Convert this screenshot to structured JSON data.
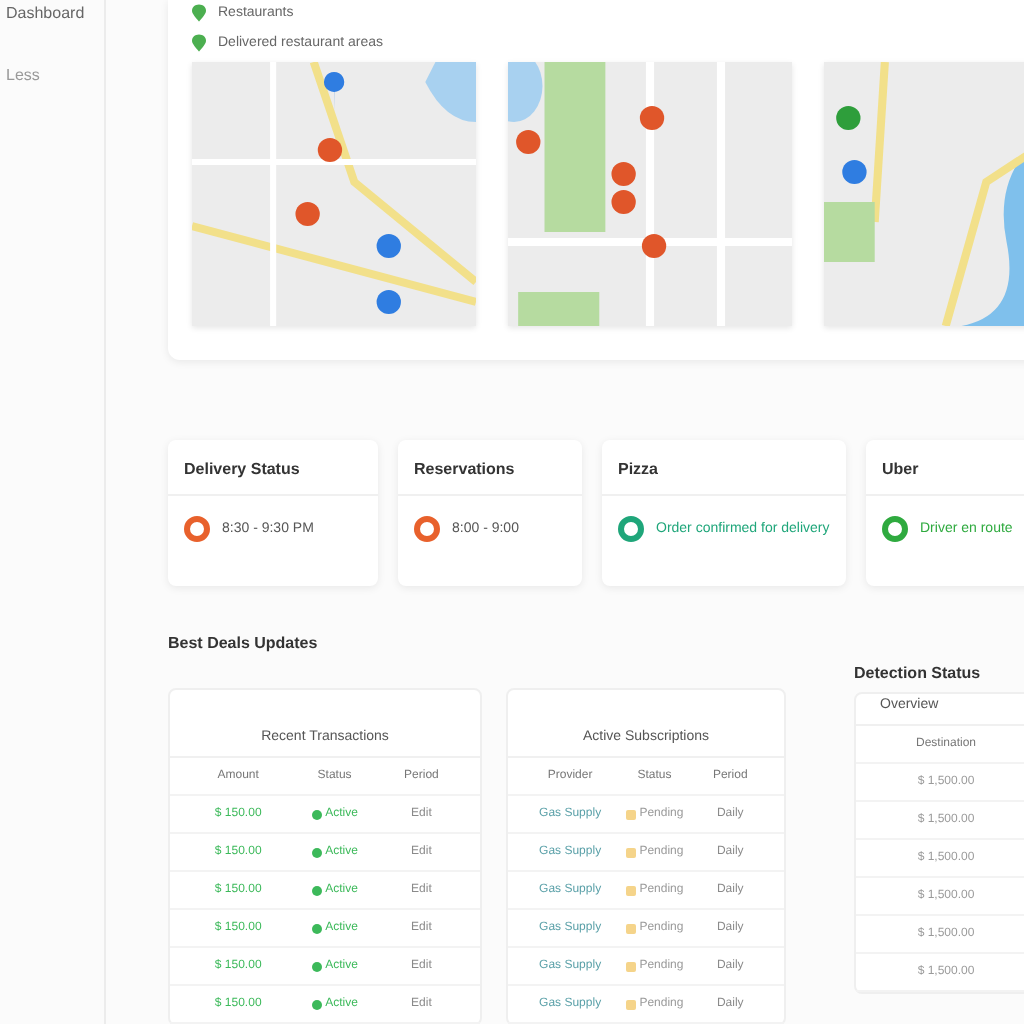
{
  "sidebar": {
    "items": [
      {
        "label": "Dashboard",
        "selected": true
      },
      {
        "label": "Less",
        "selected": false
      }
    ]
  },
  "map_panel": {
    "legend": [
      {
        "label": "Restaurants"
      },
      {
        "label": "Delivered restaurant areas"
      }
    ]
  },
  "status_cards": [
    {
      "title": "Delivery Status",
      "text": "8:30 - 9:30 PM",
      "color": "#e8612c"
    },
    {
      "title": "Reservations",
      "text": "8:00 - 9:00",
      "color": "#e8612c"
    },
    {
      "title": "Pizza",
      "text": "Order confirmed for delivery",
      "color": "#1fa67a"
    },
    {
      "title": "Uber",
      "text": "Driver en route",
      "color": "#2faa3f"
    }
  ],
  "section_title": "Best Deals Updates",
  "tables": [
    {
      "title": "Recent Transactions",
      "color": "#3cb95a",
      "columns": [
        "Amount",
        "Status",
        "Period"
      ],
      "rows": [
        [
          "$ 150.00",
          "Active",
          "Edit"
        ],
        [
          "$ 150.00",
          "Active",
          "Edit"
        ],
        [
          "$ 150.00",
          "Active",
          "Edit"
        ],
        [
          "$ 150.00",
          "Active",
          "Edit"
        ],
        [
          "$ 150.00",
          "Active",
          "Edit"
        ],
        [
          "$ 150.00",
          "Active",
          "Edit"
        ]
      ]
    },
    {
      "title": "Active Subscriptions",
      "color": "#f5d48a",
      "columns": [
        "Provider",
        "Status",
        "Period"
      ],
      "rows": [
        [
          "Gas Supply",
          "Pending",
          "Daily"
        ],
        [
          "Gas Supply",
          "Pending",
          "Daily"
        ],
        [
          "Gas Supply",
          "Pending",
          "Daily"
        ],
        [
          "Gas Supply",
          "Pending",
          "Daily"
        ],
        [
          "Gas Supply",
          "Pending",
          "Daily"
        ],
        [
          "Gas Supply",
          "Pending",
          "Daily"
        ]
      ]
    },
    {
      "heading": "Detection Status",
      "title": "Overview",
      "columns": [
        "Destination"
      ],
      "rows": [
        [
          "$ 1,500.00"
        ],
        [
          "$ 1,500.00"
        ],
        [
          "$ 1,500.00"
        ],
        [
          "$ 1,500.00"
        ],
        [
          "$ 1,500.00"
        ],
        [
          "$ 1,500.00"
        ]
      ]
    }
  ]
}
